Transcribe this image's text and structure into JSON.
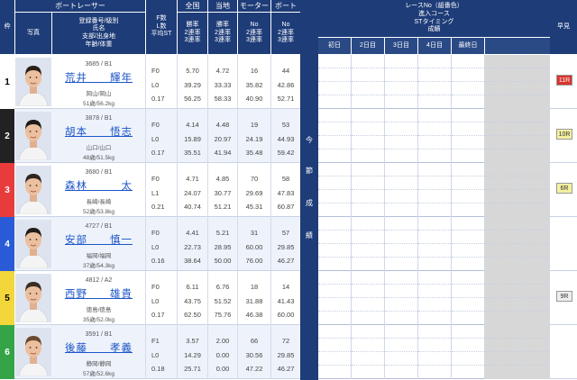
{
  "header": {
    "frame": "枠",
    "photo": "写真",
    "racer_group": "ボートレーサー",
    "racer_info_lines": [
      "登録番号/級別",
      "氏名",
      "支部/出身地",
      "年齢/体重"
    ],
    "f_col_lines": [
      "F数",
      "L数",
      "平均ST"
    ],
    "national": "全国",
    "local": "当地",
    "motor": "モーター",
    "boat": "ボート",
    "rate_lines": [
      "勝率",
      "2連率",
      "3連率"
    ],
    "no_rate_lines": [
      "No",
      "2連率",
      "3連率"
    ],
    "race_info_lines": [
      "レースNo（組番色）",
      "進入コース",
      "STタイミング",
      "成績"
    ],
    "days": [
      "初日",
      "2日目",
      "3日目",
      "4日目",
      "最終日"
    ],
    "fast": "早見"
  },
  "middle_label": [
    "今",
    "節",
    "成",
    "績"
  ],
  "racers": [
    {
      "frame": "1",
      "reg": "3685 / B1",
      "name": "荒井　　輝年",
      "branch": "岡山/岡山",
      "body": "51歳/56.2kg",
      "f": "F0",
      "l": "L0",
      "st": "0.17",
      "nat": [
        "5.70",
        "39.29",
        "56.25"
      ],
      "loc": [
        "4.72",
        "33.33",
        "58.33"
      ],
      "motor": [
        "16",
        "35.82",
        "40.90"
      ],
      "boat": [
        "44",
        "42.86",
        "52.71"
      ],
      "fast": "11R"
    },
    {
      "frame": "2",
      "reg": "3878 / B1",
      "name": "胡本　　悟志",
      "branch": "山口/山口",
      "body": "48歳/51.5kg",
      "f": "F0",
      "l": "L0",
      "st": "0.17",
      "nat": [
        "4.14",
        "15.89",
        "35.51"
      ],
      "loc": [
        "4.48",
        "20.97",
        "41.94"
      ],
      "motor": [
        "19",
        "24.19",
        "35.48"
      ],
      "boat": [
        "53",
        "44.93",
        "59.42"
      ],
      "fast": "10R"
    },
    {
      "frame": "3",
      "reg": "3680 / B1",
      "name": "森林　　　太",
      "branch": "長崎/長崎",
      "body": "52歳/53.8kg",
      "f": "F0",
      "l": "L1",
      "st": "0.21",
      "nat": [
        "4.71",
        "24.07",
        "40.74"
      ],
      "loc": [
        "4.85",
        "30.77",
        "51.21"
      ],
      "motor": [
        "70",
        "29.69",
        "45.31"
      ],
      "boat": [
        "58",
        "47.83",
        "60.87"
      ],
      "fast": "6R"
    },
    {
      "frame": "4",
      "reg": "4727 / B1",
      "name": "安部　　慎一",
      "branch": "福岡/福岡",
      "body": "37歳/54.3kg",
      "f": "F0",
      "l": "L0",
      "st": "0.16",
      "nat": [
        "4.41",
        "22.73",
        "38.64"
      ],
      "loc": [
        "5.21",
        "28.95",
        "50.00"
      ],
      "motor": [
        "31",
        "60.00",
        "76.00"
      ],
      "boat": [
        "57",
        "29.85",
        "46.27"
      ],
      "fast": ""
    },
    {
      "frame": "5",
      "reg": "4812 / A2",
      "name": "西野　　雄貴",
      "branch": "徳島/徳島",
      "body": "35歳/52.0kg",
      "f": "F0",
      "l": "L0",
      "st": "0.17",
      "nat": [
        "6.11",
        "43.75",
        "62.50"
      ],
      "loc": [
        "6.76",
        "51.52",
        "75.76"
      ],
      "motor": [
        "18",
        "31.88",
        "46.38"
      ],
      "boat": [
        "14",
        "41.43",
        "60.00"
      ],
      "fast": "9R"
    },
    {
      "frame": "6",
      "reg": "3591 / B1",
      "name": "後藤　　孝義",
      "branch": "静岡/静岡",
      "body": "57歳/52.6kg",
      "f": "F1",
      "l": "L0",
      "st": "0.18",
      "nat": [
        "3.57",
        "14.29",
        "25.71"
      ],
      "loc": [
        "2.00",
        "0.00",
        "0.00"
      ],
      "motor": [
        "66",
        "30.56",
        "47.22"
      ],
      "boat": [
        "72",
        "29.85",
        "46.27"
      ],
      "fast": ""
    }
  ],
  "colors": {
    "frame_bg": [
      "#ffffff",
      "#222222",
      "#e83c3c",
      "#2a5bd7",
      "#f2d63a",
      "#35a447"
    ],
    "frame_fg": [
      "#000000",
      "#ffffff",
      "#ffffff",
      "#ffffff",
      "#000000",
      "#ffffff"
    ],
    "badge_bg": [
      "#d8342c",
      "#f3f0a0",
      "#f3f0a0",
      "",
      "#eeeeee",
      ""
    ],
    "badge_fg": [
      "#ffffff",
      "#333333",
      "#333333",
      "",
      "#333333",
      ""
    ]
  }
}
